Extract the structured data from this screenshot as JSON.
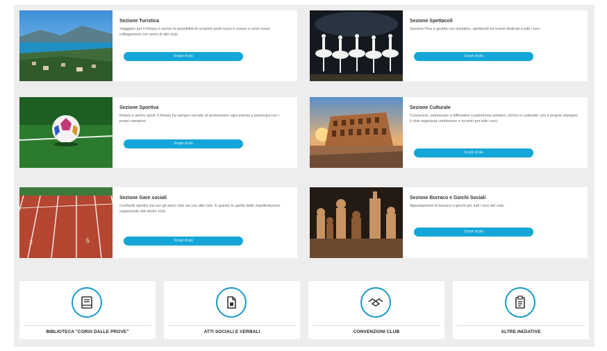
{
  "sections": [
    {
      "title": "Sezione Turistica",
      "desc": "Viaggiare per il Rotary è anche la possibilità di scoprire posti nuovi e creare o unire nuovi collegamenti con amici di altri club.",
      "button": "Scopri di più",
      "photo": "lake-landscape-photo"
    },
    {
      "title": "Sezione Spettacoli",
      "desc": "Sezione Pisa è gestita con iniziative, spettacoli ed eventi dedicati a tutti i soci.",
      "button": "Scopri di più",
      "photo": "ballet-photo"
    },
    {
      "title": "Sezione Sportiva",
      "desc": "Rotary è anche sport: il Rotary ha sempre cercato di promuovere ogni evento e partecipa con i propri campioni.",
      "button": "Scopri di più",
      "photo": "soccer-ball-photo"
    },
    {
      "title": "Sezione Culturale",
      "desc": "Conoscere, valorizzare e diffondere il patrimonio artistico, storico e culturale: con il proprio impegno il club organizza conferenze e incontri per tutti i soci.",
      "button": "Scopri di più",
      "photo": "colosseum-photo"
    },
    {
      "title": "Sezione Gare sociali",
      "desc": "Confronti sportivi sia con gli amici club sia con altri club. È questo lo spirito delle manifestazioni organizzate dal nostro club.",
      "button": "Scopri di più",
      "photo": "running-track-photo"
    },
    {
      "title": "Sezione Burraco e Giochi Sociali",
      "desc": "Appuntamenti di burraco e giochi per tutti i soci del club.",
      "button": "Scopri di più",
      "photo": "chess-photo"
    }
  ],
  "tiles": [
    {
      "label": "BIBLIOTECA \"CORSI DALLE PROVE\"",
      "icon": "book-icon"
    },
    {
      "label": "ATTI SOCIALI E VERBALI",
      "icon": "document-icon"
    },
    {
      "label": "CONVENZIONI CLUB",
      "icon": "handshake-icon"
    },
    {
      "label": "ALTRE INIZIATIVE",
      "icon": "clipboard-icon"
    }
  ],
  "colors": {
    "accent": "#14a6d8",
    "icon_ring": "#1599c8",
    "background": "#eeeded"
  }
}
